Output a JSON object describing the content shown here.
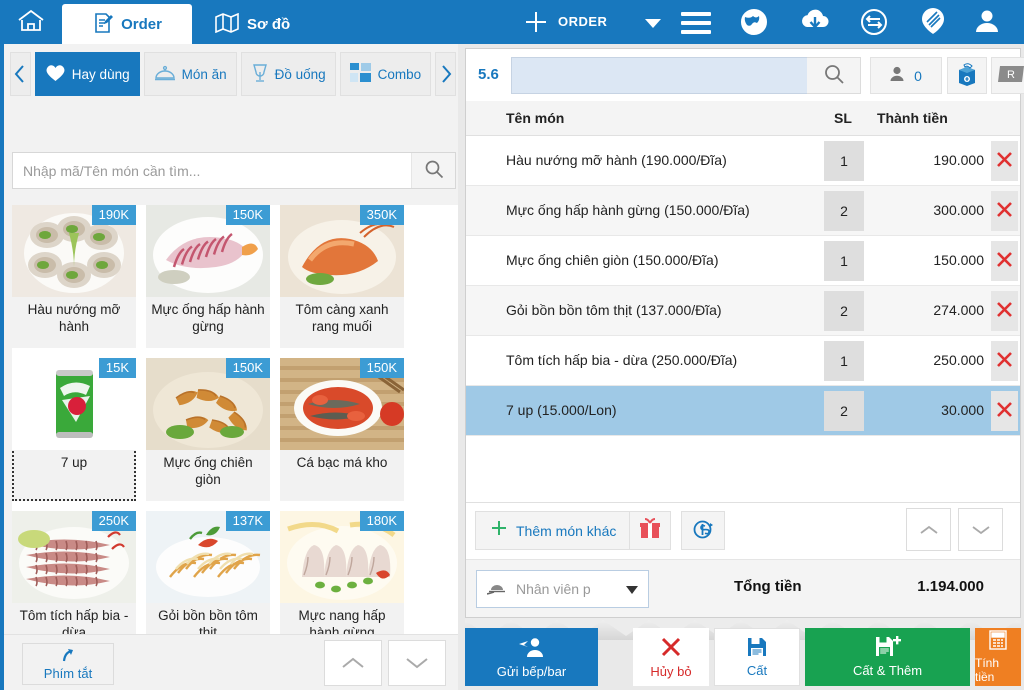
{
  "topbar": {
    "home_icon": "home-icon",
    "tabs": [
      {
        "label": "Order",
        "icon": "order-document-icon",
        "active": true
      },
      {
        "label": "Sơ đồ",
        "icon": "map-icon",
        "active": false
      }
    ],
    "order_label": "ORDER",
    "icons": [
      "plus-icon",
      "caret-down-icon",
      "hamburger-menu-icon",
      "globe-icon",
      "cloud-download-icon",
      "sync-icon",
      "tag-icon",
      "user-account-icon"
    ]
  },
  "left": {
    "nav_prev": "chevron-left-icon",
    "nav_next": "chevron-right-icon",
    "categories": [
      {
        "label": "Hay dùng",
        "icon": "heart-icon",
        "active": true
      },
      {
        "label": "Món ăn",
        "icon": "food-cloche-icon",
        "active": false
      },
      {
        "label": "Đồ uống",
        "icon": "wine-glass-icon",
        "active": false
      },
      {
        "label": "Combo",
        "icon": "combo-grid-icon",
        "active": false
      }
    ],
    "search": {
      "value": "",
      "placeholder": "Nhập mã/Tên món cần tìm...",
      "icon": "search-icon"
    },
    "products": [
      {
        "name": "Hàu nướng mỡ hành",
        "price_badge": "190K",
        "image": "oysters",
        "selected": false
      },
      {
        "name": "Mực ống hấp hành gừng",
        "price_badge": "150K",
        "image": "squid-steam",
        "selected": false
      },
      {
        "name": "Tôm càng xanh rang muối",
        "price_badge": "350K",
        "image": "prawn-salt",
        "selected": false
      },
      {
        "name": "7 up",
        "price_badge": "15K",
        "image": "7up-can",
        "selected": true
      },
      {
        "name": "Mực ống chiên giòn",
        "price_badge": "150K",
        "image": "squid-fried",
        "selected": false
      },
      {
        "name": "Cá bạc má kho",
        "price_badge": "150K",
        "image": "fish-braised",
        "selected": false
      },
      {
        "name": "Tôm tích hấp bia - dừa",
        "price_badge": "250K",
        "image": "mantis-shrimp",
        "selected": false
      },
      {
        "name": "Gỏi bồn bồn tôm thịt",
        "price_badge": "137K",
        "image": "salad-shrimp",
        "selected": false
      },
      {
        "name": "Mực nang hấp hành gừng",
        "price_badge": "180K",
        "image": "cuttlefish",
        "selected": false
      }
    ],
    "footer": {
      "hotkey_label": "Phím tắt",
      "hotkey_icon": "arrow-shortcut-icon",
      "scroll_up_icon": "chevron-up-icon",
      "scroll_down_icon": "chevron-down-icon"
    }
  },
  "order": {
    "table_number": "5.6",
    "search_value": "",
    "search_icon": "search-icon",
    "guest_count": "0",
    "guest_icon": "person-icon",
    "takeaway_icon": "takeaway-bag-icon",
    "r_badge": "R",
    "columns": {
      "name": "Tên món",
      "qty": "SL",
      "amount": "Thành tiền"
    },
    "items": [
      {
        "name": "Hàu nướng mỡ hành (190.000/Đĩa)",
        "qty": "1",
        "amount": "190.000",
        "selected": false
      },
      {
        "name": "Mực ống hấp hành gừng (150.000/Đĩa)",
        "qty": "2",
        "amount": "300.000",
        "selected": false
      },
      {
        "name": "Mực ống chiên giòn (150.000/Đĩa)",
        "qty": "1",
        "amount": "150.000",
        "selected": false
      },
      {
        "name": "Gỏi bồn bồn tôm thịt (137.000/Đĩa)",
        "qty": "2",
        "amount": "274.000",
        "selected": false
      },
      {
        "name": "Tôm tích hấp bia - dừa (250.000/Đĩa)",
        "qty": "1",
        "amount": "250.000",
        "selected": false
      },
      {
        "name": "7 up (15.000/Lon)",
        "qty": "2",
        "amount": "30.000",
        "selected": true
      }
    ],
    "delete_icon": "red-x-icon",
    "add_more_label": "Thêm món khác",
    "add_more_icon": "plus-icon",
    "gift_icon": "gift-icon",
    "discount_icon": "money-discount-icon",
    "row_up_icon": "chevron-up-icon",
    "row_down_icon": "chevron-down-icon",
    "staff_placeholder": "Nhân viên p",
    "staff_icon": "waiter-cloche-icon",
    "staff_caret": "caret-down-icon",
    "total_label": "Tổng tiền",
    "total_value": "1.194.000",
    "actions": [
      {
        "label": "Gửi bếp/bar",
        "icon": "chef-send-icon",
        "style": "primary"
      },
      {
        "label": "Hủy bỏ",
        "icon": "red-x-icon",
        "style": "white-red"
      },
      {
        "label": "Cất",
        "icon": "save-icon",
        "style": "white-blue"
      },
      {
        "label": "Cất & Thêm",
        "icon": "save-plus-icon",
        "style": "green"
      },
      {
        "label": "Tính tiền",
        "icon": "calculator-icon",
        "style": "orange"
      }
    ]
  },
  "colors": {
    "brand_blue": "#1878be",
    "badge_blue": "#3c9cd4",
    "selected_row": "#9fc9e6",
    "green": "#18a251",
    "orange": "#ef7f22",
    "red": "#d62a2a"
  }
}
